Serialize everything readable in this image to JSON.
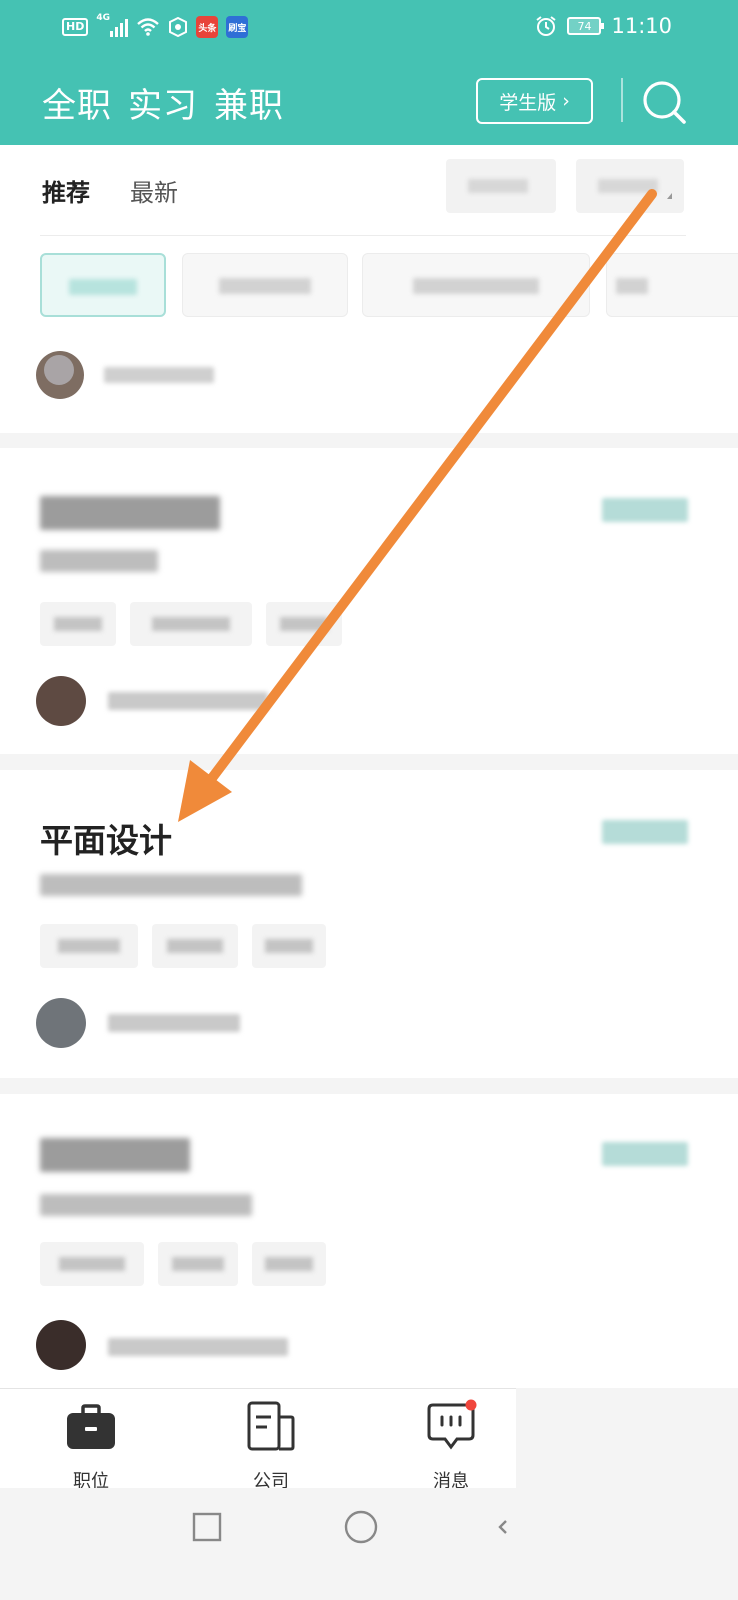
{
  "status_bar": {
    "network": "4G",
    "battery": "74",
    "time": "11:10",
    "app_icons": [
      {
        "name": "toutiao-app-icon",
        "label": "头条",
        "color": "#e8443a"
      },
      {
        "name": "weibo-app-icon",
        "label": "刷宝",
        "color": "#2f6fd6"
      }
    ]
  },
  "header": {
    "tabs": [
      {
        "label": "全职",
        "active": true
      },
      {
        "label": "实习",
        "active": false
      },
      {
        "label": "兼职",
        "active": false
      }
    ],
    "student_button": "学生版",
    "chevron": "›",
    "accent_color": "#45c2b3"
  },
  "filter": {
    "sort_tabs": [
      {
        "label": "推荐",
        "active": true
      },
      {
        "label": "最新",
        "active": false
      }
    ]
  },
  "cards": [
    {
      "title": "平面设计",
      "visible_title": true
    }
  ],
  "bottom_nav": [
    {
      "label": "职位",
      "icon": "briefcase-icon",
      "active": true
    },
    {
      "label": "公司",
      "icon": "company-icon",
      "active": false
    },
    {
      "label": "消息",
      "icon": "message-icon",
      "active": false,
      "badge": true
    }
  ],
  "colors": {
    "teal": "#45c2b3",
    "arrow": "#f08a3a",
    "badge_red": "#f0463c"
  }
}
